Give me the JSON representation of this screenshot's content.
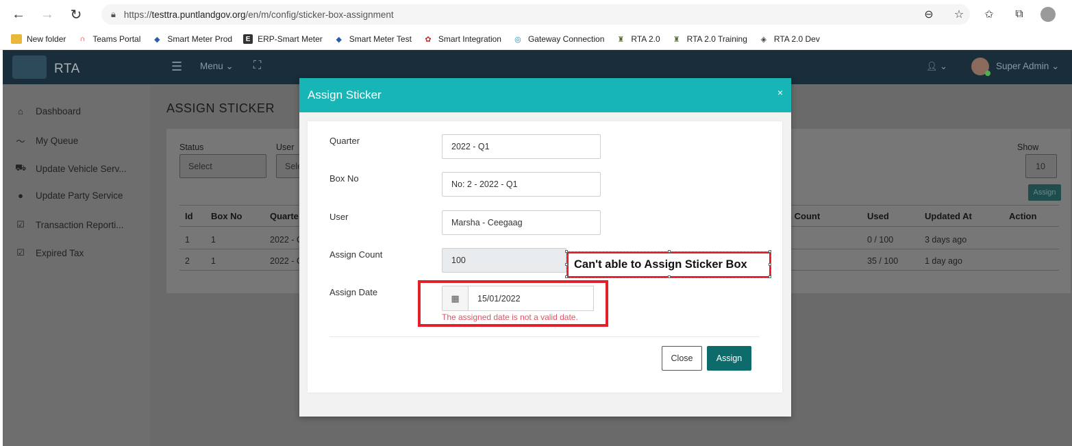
{
  "browser": {
    "url_scheme": "https://",
    "url_host": "testtra.puntlandgov.org",
    "url_path": "/en/m/config/sticker-box-assignment",
    "bookmarks": [
      "New folder",
      "Teams Portal",
      "Smart Meter Prod",
      "ERP-Smart Meter",
      "Smart Meter Test",
      "Smart Integration",
      "Gateway Connection",
      "RTA 2.0",
      "RTA 2.0 Training",
      "RTA 2.0 Dev"
    ]
  },
  "app": {
    "brand": "RTA",
    "menu_label": "Menu ⌄",
    "user_name": "Super Admin ⌄",
    "user_caret": "⌄"
  },
  "sidebar": {
    "items": [
      "Dashboard",
      "My Queue",
      "Update Vehicle Serv...",
      "Update Party Service",
      "Transaction Reporti...",
      "Expired Tax"
    ]
  },
  "page": {
    "title": "ASSIGN STICKER",
    "filters": {
      "status_label": "Status",
      "status_value": "Select",
      "user_label": "User",
      "user_value": "Sele",
      "show_label": "Show",
      "show_value": "10",
      "assign_btn": "Assign"
    },
    "table": {
      "headers": [
        "Id",
        "Box No",
        "Quarte",
        "rn Count",
        "Used",
        "Updated At",
        "Action"
      ],
      "rows": [
        {
          "id": "1",
          "box": "1",
          "quarter": "2022 - C",
          "used": "0 / 100",
          "updated": "3 days ago"
        },
        {
          "id": "2",
          "box": "1",
          "quarter": "2022 - C",
          "used": "35 / 100",
          "updated": "1 day ago"
        }
      ]
    }
  },
  "modal": {
    "title": "Assign Sticker",
    "close_x": "×",
    "fields": {
      "quarter_label": "Quarter",
      "quarter_value": "2022 - Q1",
      "box_label": "Box No",
      "box_value": "No: 2 - 2022 - Q1",
      "user_label": "User",
      "user_value": "Marsha - Ceegaag",
      "count_label": "Assign Count",
      "count_value": "100",
      "date_label": "Assign Date",
      "date_value": "15/01/2022",
      "date_error": "The assigned date is not a valid date."
    },
    "buttons": {
      "close": "Close",
      "assign": "Assign"
    }
  },
  "annotation": {
    "callout_text": "Can't able to Assign Sticker Box",
    "color": "#e3202a"
  }
}
